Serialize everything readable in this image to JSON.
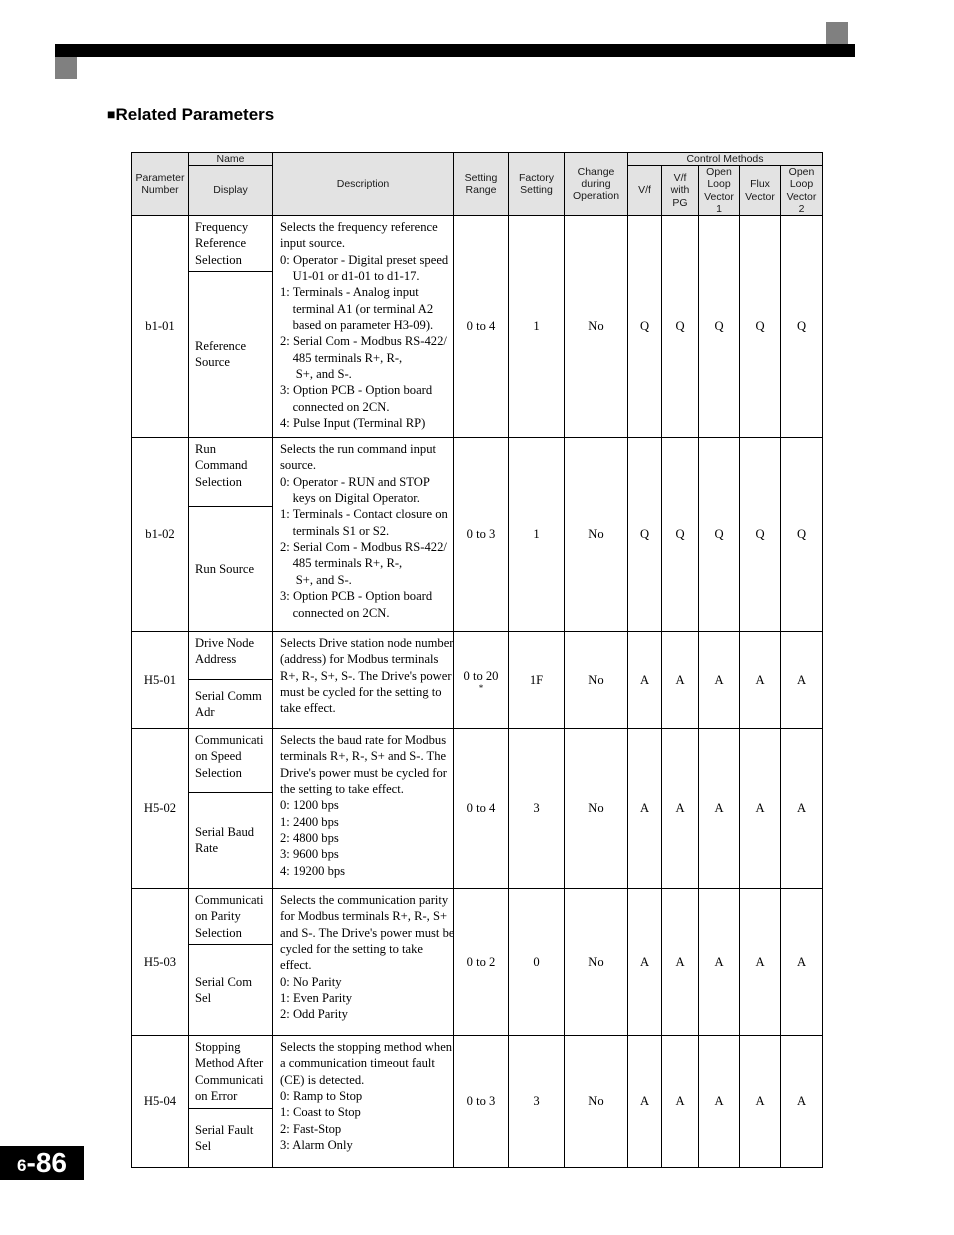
{
  "page": {
    "heading": "Related Parameters",
    "heading_bullet": "square-bullet-icon",
    "page_number_volume": "6",
    "page_number_page": "-86"
  },
  "table": {
    "headers": {
      "parameter_number": "Parameter\nNumber",
      "name": "Name",
      "display": "Display",
      "description": "Description",
      "setting_range": "Setting\nRange",
      "factory_setting": "Factory\nSetting",
      "change_during_operation": "Change\nduring\nOperation",
      "control_methods": "Control Methods",
      "control_columns": [
        "V/f",
        "V/f\nwith\nPG",
        "Open\nLoop\nVector\n1",
        "Flux\nVector",
        "Open\nLoop\nVector\n2"
      ]
    },
    "rows": [
      {
        "parameter_number": "b1-01",
        "name": "Frequency\nReference\nSelection",
        "display": "Reference\nSource",
        "description_intro": "Selects the frequency reference\ninput source.",
        "description_items": [
          "0: Operator - Digital preset speed\n    U1-01 or d1-01 to d1-17.",
          "1: Terminals - Analog input\n    terminal A1 (or terminal A2\n    based on parameter H3-09).",
          "2: Serial Com - Modbus RS-422/\n    485 terminals R+, R-,\n     S+, and S-.",
          "3: Option PCB - Option board\n    connected on 2CN.",
          "4: Pulse Input (Terminal RP)"
        ],
        "setting_range": "0 to 4",
        "setting_range_note": "",
        "factory_setting": "1",
        "change_during_operation": "No",
        "control_values": [
          "Q",
          "Q",
          "Q",
          "Q",
          "Q"
        ]
      },
      {
        "parameter_number": "b1-02",
        "name": "Run\nCommand\nSelection",
        "display": "Run Source",
        "description_intro": "Selects the run command input\nsource.",
        "description_items": [
          "0: Operator - RUN and STOP\n    keys on Digital Operator.",
          "1: Terminals - Contact closure on\n    terminals S1 or S2.",
          "2: Serial Com - Modbus RS-422/\n    485 terminals R+, R-,\n     S+, and S-.",
          "3: Option PCB - Option board\n    connected on 2CN."
        ],
        "setting_range": "0 to 3",
        "setting_range_note": "",
        "factory_setting": "1",
        "change_during_operation": "No",
        "control_values": [
          "Q",
          "Q",
          "Q",
          "Q",
          "Q"
        ]
      },
      {
        "parameter_number": "H5-01",
        "name": "Drive Node\nAddress",
        "display": "Serial Comm\nAdr",
        "description_intro": "Selects Drive station node number\n(address) for Modbus terminals\nR+, R-, S+, S-. The Drive's power\nmust be cycled for the setting to\ntake effect.",
        "description_items": [],
        "setting_range": "0 to 20",
        "setting_range_note": "*",
        "factory_setting": "1F",
        "change_during_operation": "No",
        "control_values": [
          "A",
          "A",
          "A",
          "A",
          "A"
        ]
      },
      {
        "parameter_number": "H5-02",
        "name": "Communicati\non Speed\nSelection",
        "display": "Serial Baud\nRate",
        "description_intro": "Selects the baud rate for Modbus\nterminals R+, R-, S+ and S-. The\nDrive's power must be cycled for\nthe setting to take effect.",
        "description_items": [
          "0: 1200 bps",
          "1: 2400 bps",
          "2: 4800 bps",
          "3: 9600 bps",
          "4: 19200 bps"
        ],
        "setting_range": "0 to 4",
        "setting_range_note": "",
        "factory_setting": "3",
        "change_during_operation": "No",
        "control_values": [
          "A",
          "A",
          "A",
          "A",
          "A"
        ]
      },
      {
        "parameter_number": "H5-03",
        "name": "Communicati\non Parity\nSelection",
        "display": "Serial Com\nSel",
        "description_intro": "Selects the communication parity\nfor Modbus terminals R+, R-, S+\nand S-. The Drive's power must be\ncycled for the setting to take\neffect.",
        "description_items": [
          "0: No Parity",
          "1: Even Parity",
          "2: Odd Parity"
        ],
        "setting_range": "0 to 2",
        "setting_range_note": "",
        "factory_setting": "0",
        "change_during_operation": "No",
        "control_values": [
          "A",
          "A",
          "A",
          "A",
          "A"
        ]
      },
      {
        "parameter_number": "H5-04",
        "name": "Stopping\nMethod After\nCommunicati\non Error",
        "display": "Serial Fault\nSel",
        "description_intro": "Selects the stopping method when\na communication timeout fault\n(CE) is detected.",
        "description_items": [
          "0: Ramp to Stop",
          "1: Coast to Stop",
          "2: Fast-Stop",
          "3: Alarm Only"
        ],
        "setting_range": "0 to 3",
        "setting_range_note": "",
        "factory_setting": "3",
        "change_during_operation": "No",
        "control_values": [
          "A",
          "A",
          "A",
          "A",
          "A"
        ]
      }
    ]
  }
}
